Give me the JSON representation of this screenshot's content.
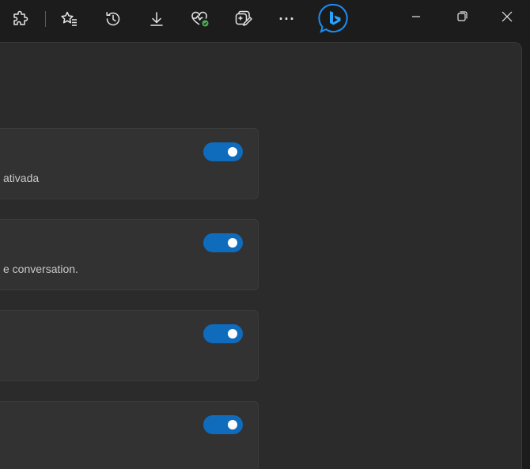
{
  "toolbar": {
    "buttons": [
      {
        "name": "extensions-icon"
      },
      {
        "name": "favorites-icon"
      },
      {
        "name": "history-icon"
      },
      {
        "name": "downloads-icon"
      },
      {
        "name": "browser-essentials-icon"
      },
      {
        "name": "collections-icon"
      },
      {
        "name": "more-icon",
        "glyph": "···"
      },
      {
        "name": "bing-copilot-icon"
      }
    ],
    "window_controls": {
      "minimize_glyph": "—",
      "restore_glyph": "❐",
      "close_glyph": "✕"
    },
    "colors": {
      "bing_accent": "#1c8ef2",
      "health_badge": "#4caf50"
    }
  },
  "settings": {
    "cards": [
      {
        "description": "ativada",
        "enabled": true
      },
      {
        "description": "e conversation.",
        "enabled": true
      },
      {
        "description": "",
        "enabled": true
      },
      {
        "description": "",
        "enabled": true
      }
    ]
  },
  "colors": {
    "toggle_on": "#0f6cbd",
    "panel_bg": "#2b2b2b",
    "card_bg": "#323232"
  }
}
